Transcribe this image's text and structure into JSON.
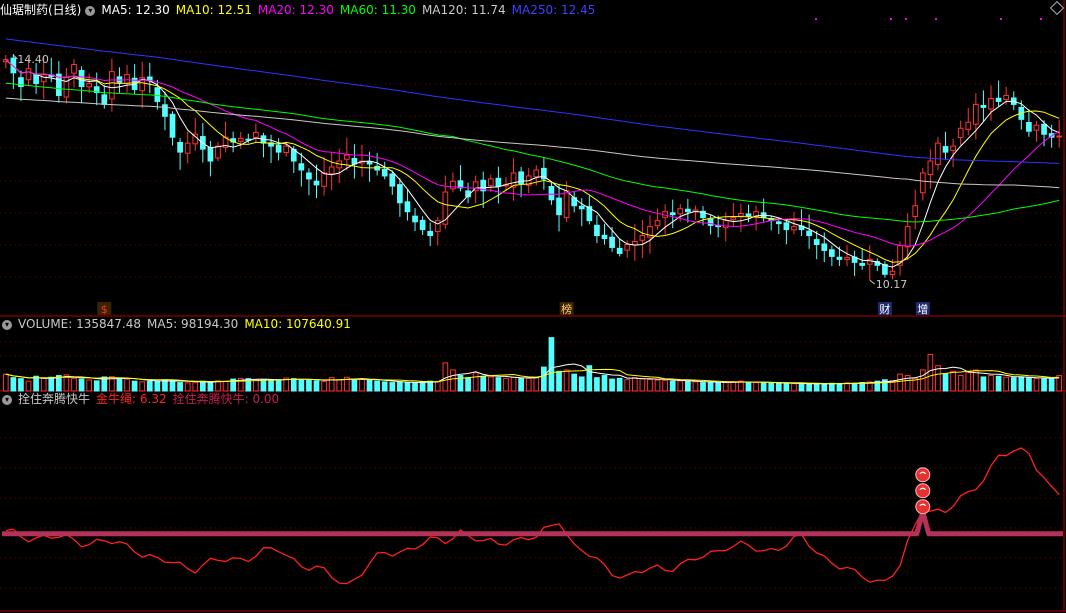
{
  "header": {
    "title": "仙琚制药(日线)",
    "ma_items": [
      {
        "label": "MA5: 12.30",
        "color": "#ffffff"
      },
      {
        "label": "MA10: 12.51",
        "color": "#ffff00"
      },
      {
        "label": "MA20: 12.30",
        "color": "#ff00ff"
      },
      {
        "label": "MA60: 11.30",
        "color": "#00ff00"
      },
      {
        "label": "MA120: 11.74",
        "color": "#c8c8c8"
      },
      {
        "label": "MA250: 12.45",
        "color": "#4040ff"
      }
    ]
  },
  "volume_header": {
    "items": [
      {
        "label": "VOLUME: 135847.48",
        "color": "#c8c8c8"
      },
      {
        "label": "MA5: 98194.30",
        "color": "#c8c8c8"
      },
      {
        "label": "MA10: 107640.91",
        "color": "#ffff00"
      }
    ]
  },
  "indicator_header": {
    "name": "拴住奔腾快牛",
    "items": [
      {
        "label": "金牛绳: 6.32",
        "color": "#ff2020"
      },
      {
        "label": "拴住奔腾快牛: 0.00",
        "color": "#c81e50"
      }
    ]
  },
  "markers": {
    "high_label": "14.40",
    "low_label": "10.17",
    "tags": [
      {
        "text": "$",
        "idx": 13,
        "color": "#ff3030"
      },
      {
        "text": "榜",
        "idx": 74,
        "color": "#ffcc66"
      },
      {
        "text": "财",
        "idx": 116,
        "color": "#ffffff"
      },
      {
        "text": "增",
        "idx": 121,
        "color": "#ffffff"
      }
    ]
  },
  "chart_data": [
    {
      "type": "candlestick",
      "name": "price",
      "colors": {
        "up": "#ff3232",
        "down": "#54ffff",
        "ma5": "#ffffff",
        "ma10": "#ffff00",
        "ma20": "#ff00ff",
        "ma60": "#00ff00",
        "ma120": "#c8c8c8",
        "ma250": "#3232ff"
      },
      "ylim": [
        9.7,
        14.7
      ],
      "start": 13.97,
      "seed": 7,
      "closes": [
        14.0,
        13.78,
        13.55,
        13.85,
        13.6,
        13.75,
        13.72,
        13.4,
        13.7,
        13.92,
        13.55,
        13.6,
        13.45,
        13.25,
        13.8,
        13.62,
        13.75,
        13.5,
        13.7,
        13.65,
        13.3,
        13.05,
        12.7,
        12.45,
        12.6,
        12.75,
        12.5,
        12.3,
        12.55,
        12.7,
        12.62,
        12.68,
        12.65,
        12.78,
        12.6,
        12.55,
        12.45,
        12.55,
        12.3,
        12.15,
        12.0,
        11.9,
        12.1,
        12.2,
        12.3,
        12.4,
        12.25,
        12.3,
        12.25,
        12.15,
        12.05,
        11.88,
        11.6,
        11.45,
        11.28,
        11.15,
        11.05,
        11.3,
        11.78,
        11.96,
        11.85,
        11.7,
        11.95,
        11.8,
        12.0,
        11.88,
        11.9,
        12.1,
        11.92,
        12.05,
        12.15,
        12.0,
        11.65,
        11.4,
        11.8,
        11.55,
        11.5,
        11.3,
        11.05,
        11.0,
        10.85,
        10.75,
        10.9,
        10.95,
        11.05,
        11.2,
        11.3,
        11.45,
        11.4,
        11.5,
        11.45,
        11.48,
        11.35,
        11.22,
        11.2,
        11.3,
        11.35,
        11.42,
        11.38,
        11.45,
        11.35,
        11.3,
        11.25,
        11.15,
        11.2,
        11.15,
        11.05,
        10.9,
        10.8,
        10.7,
        10.65,
        10.68,
        10.6,
        10.55,
        10.65,
        10.55,
        10.4,
        10.45,
        10.88,
        11.2,
        11.55,
        12.1,
        12.3,
        12.6,
        12.45,
        12.55,
        12.85,
        12.95,
        13.25,
        13.2,
        13.35,
        13.3,
        13.4,
        13.25,
        13.0,
        12.8,
        12.9,
        12.75,
        12.7,
        12.72
      ]
    },
    {
      "type": "bar",
      "name": "volume",
      "ylim": [
        0,
        420000
      ],
      "values": [
        120000,
        95000,
        88000,
        70000,
        105000,
        92000,
        98000,
        110000,
        115000,
        90000,
        85000,
        78000,
        72000,
        100000,
        102000,
        88000,
        85000,
        70000,
        65000,
        68000,
        72000,
        80000,
        75000,
        60000,
        58000,
        62000,
        70000,
        65000,
        72000,
        70000,
        85000,
        90000,
        88000,
        82000,
        78000,
        75000,
        80000,
        92000,
        88000,
        80000,
        75000,
        72000,
        68000,
        95000,
        80000,
        98000,
        85000,
        82000,
        78000,
        70000,
        65000,
        60000,
        62000,
        58000,
        60000,
        65000,
        70000,
        68000,
        200000,
        150000,
        110000,
        95000,
        130000,
        105000,
        100000,
        95000,
        90000,
        98000,
        92000,
        90000,
        95000,
        170000,
        380000,
        140000,
        150000,
        120000,
        100000,
        180000,
        95000,
        110000,
        85000,
        90000,
        80000,
        95000,
        88000,
        82000,
        78000,
        75000,
        70000,
        72000,
        68000,
        66000,
        60000,
        62000,
        58000,
        60000,
        65000,
        70000,
        62000,
        60000,
        58000,
        55000,
        54000,
        56000,
        52000,
        50000,
        48000,
        52000,
        50000,
        55000,
        54000,
        58000,
        56000,
        60000,
        65000,
        70000,
        80000,
        75000,
        120000,
        110000,
        90000,
        150000,
        260000,
        180000,
        120000,
        140000,
        110000,
        130000,
        150000,
        100000,
        110000,
        105000,
        98000,
        95000,
        100000,
        92000,
        90000,
        88000,
        86000,
        110000
      ]
    },
    {
      "type": "line",
      "name": "金牛绳",
      "ylim": [
        -70,
        115
      ],
      "x": [
        0,
        8,
        13,
        17,
        20,
        25,
        32,
        36,
        40,
        45,
        50,
        55,
        58,
        60,
        63,
        66,
        70,
        73,
        75,
        78,
        82,
        86,
        90,
        95,
        100,
        105,
        108,
        112,
        116,
        118,
        121,
        124,
        127,
        131,
        135,
        138,
        140
      ],
      "values": [
        0,
        -5,
        -8,
        -12,
        -25,
        -30,
        -20,
        -15,
        -30,
        -45,
        -18,
        -10,
        -5,
        3,
        -10,
        -5,
        -5,
        15,
        -12,
        -25,
        -40,
        -30,
        -28,
        -10,
        -15,
        -5,
        -20,
        -38,
        -42,
        -30,
        25,
        20,
        35,
        70,
        75,
        40,
        30
      ],
      "baseline": 0,
      "spike": {
        "idx": 121,
        "value": 20,
        "dots": 3
      }
    }
  ]
}
